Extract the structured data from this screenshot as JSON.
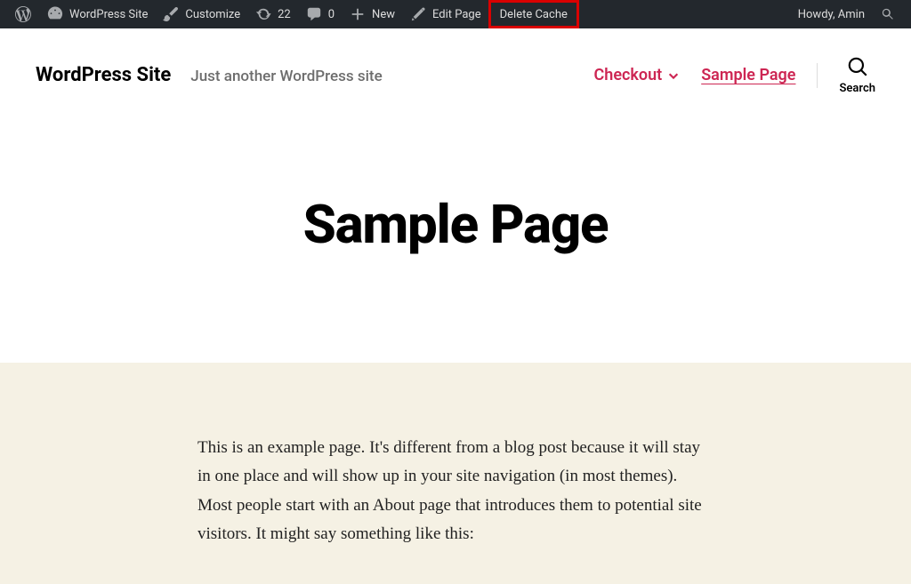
{
  "adminBar": {
    "siteName": "WordPress Site",
    "customize": "Customize",
    "updateCount": "22",
    "commentCount": "0",
    "new": "New",
    "editPage": "Edit Page",
    "deleteCache": "Delete Cache",
    "howdy": "Howdy, Amin"
  },
  "header": {
    "siteTitle": "WordPress Site",
    "tagline": "Just another WordPress site",
    "nav": {
      "checkout": "Checkout",
      "samplePage": "Sample Page"
    },
    "searchLabel": "Search"
  },
  "page": {
    "title": "Sample Page",
    "body": "This is an example page. It's different from a blog post because it will stay in one place and will show up in your site navigation (in most themes). Most people start with an About page that introduces them to potential site visitors. It might say something like this:"
  }
}
